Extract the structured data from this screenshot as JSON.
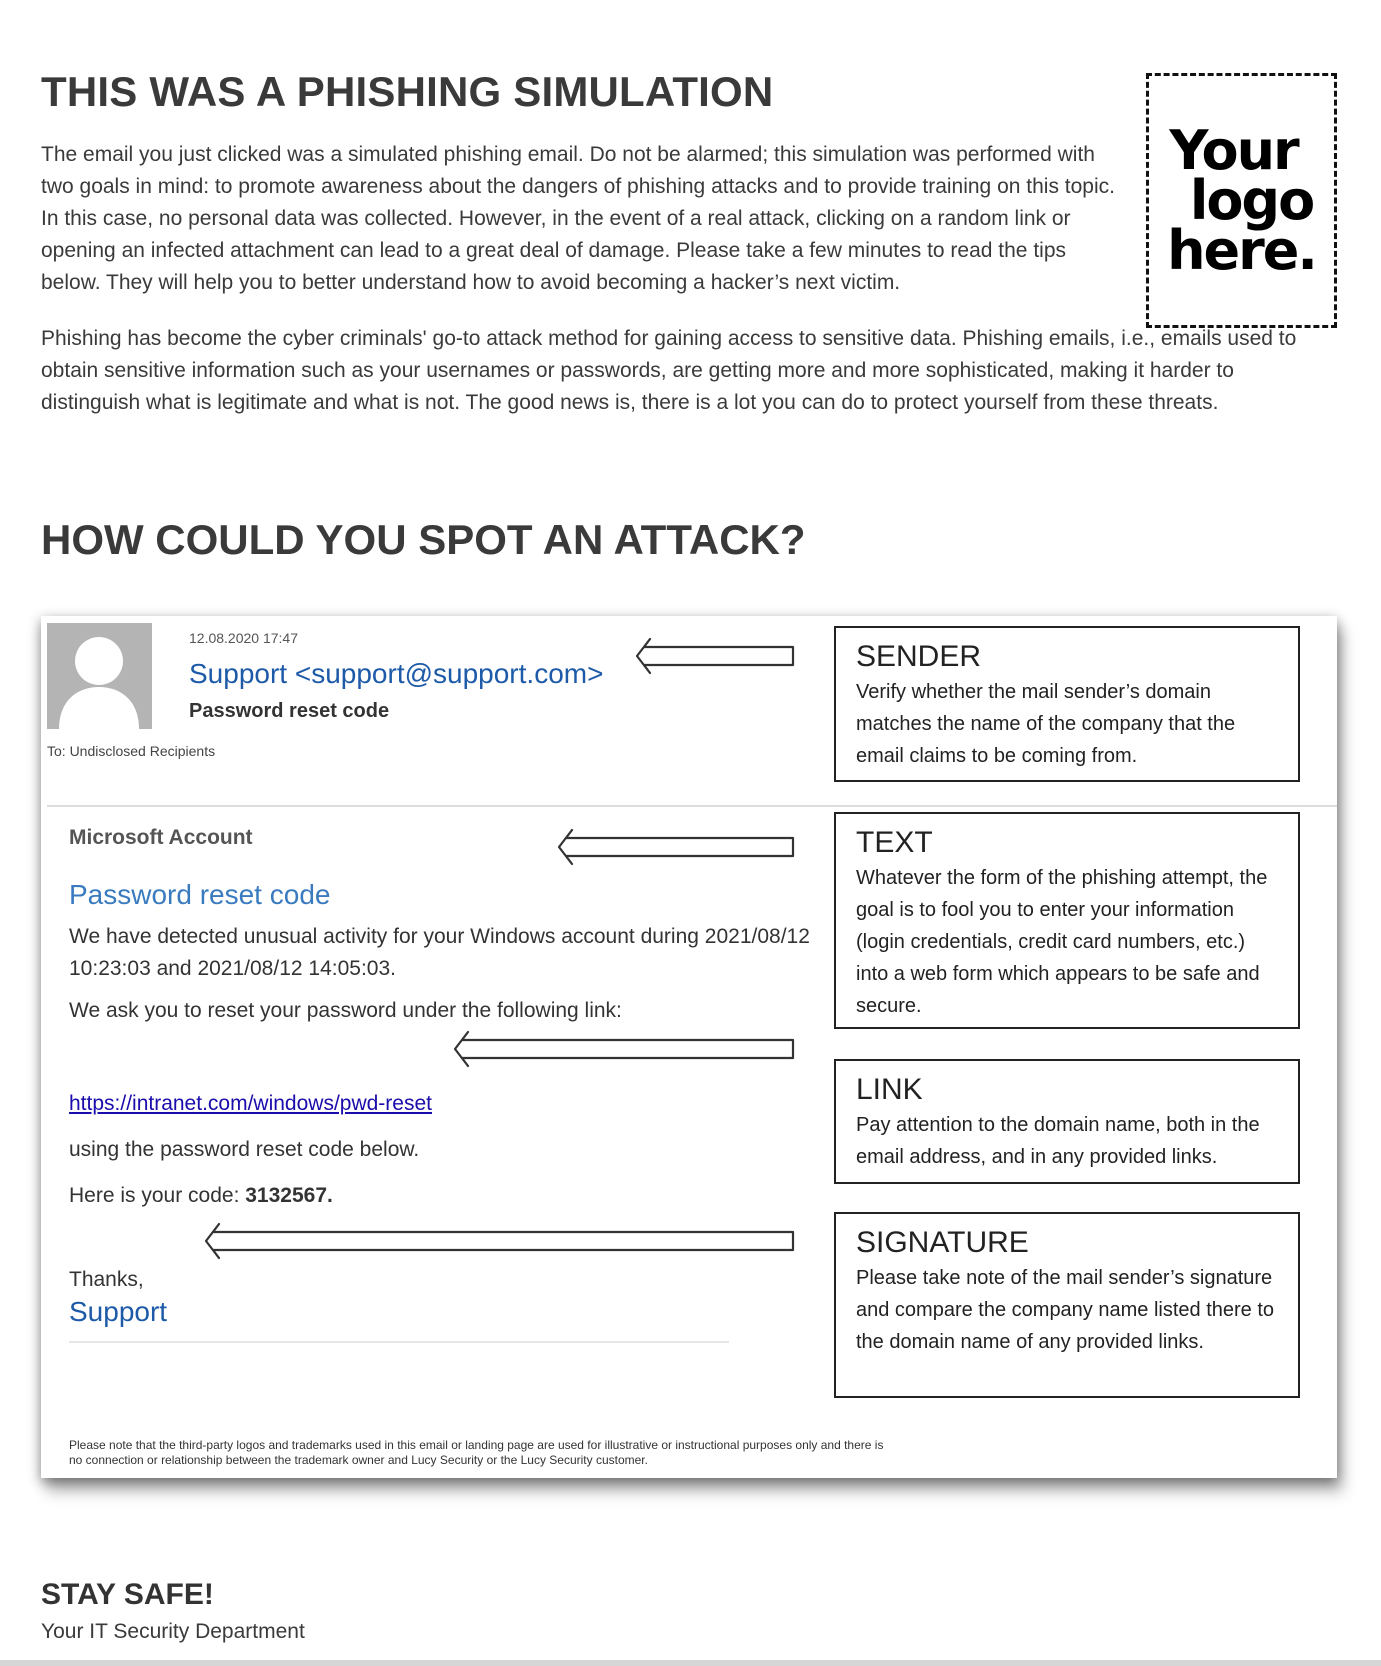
{
  "intro": {
    "title": "THIS WAS A PHISHING SIMULATION",
    "paragraph1": "The email you just clicked was a simulated phishing email. Do not be alarmed; this simulation was performed with two goals in mind: to promote awareness about the dangers of phishing attacks and to provide training on this topic. In this case, no personal data was collected. However, in the event of a real attack, clicking on a random link or opening an infected attachment can lead to a great deal of damage. Please take a few minutes to read the tips below. They will help you to better understand how to avoid becoming a hacker’s next victim.",
    "paragraph2": "Phishing has become the cyber criminals' go-to attack method for gaining access to sensitive data. Phishing emails, i.e., emails used to obtain sensitive information such as your usernames or passwords, are getting more and more sophisticated, making it harder to distinguish what is legitimate and what is not. The good news is, there is a lot you can do to protect yourself from these threats."
  },
  "logo": {
    "line1": "Your",
    "line2": "logo",
    "line3": "here."
  },
  "section2": {
    "title": "HOW COULD YOU SPOT AN ATTACK?"
  },
  "email": {
    "date": "12.08.2020 17:47",
    "sender": "Support <support@support.com>",
    "subject": "Password reset code",
    "to": "To: Undisclosed Recipients",
    "brand": "Microsoft Account",
    "title": "Password reset code",
    "body": "We have detected unusual activity for your Windows account during 2021/08/12 10:23:03 and 2021/08/12 14:05:03.",
    "ask": "We ask you to reset your password under the following link:",
    "link": "https://intranet.com/windows/pwd-reset",
    "using": "using the password reset code below.",
    "code_prefix": "Here is your code: ",
    "code": "3132567.",
    "thanks": "Thanks,",
    "signature": "Support",
    "disclaimer": "Please note that the third-party logos and trademarks used in this email or landing page are used for illustrative or instructional purposes only and there is no connection or relationship between the trademark owner and Lucy Security or the Lucy Security customer."
  },
  "callouts": {
    "sender": {
      "title": "SENDER",
      "text": "Verify whether the mail sender’s domain matches the name of the company that the email claims to be coming from."
    },
    "text": {
      "title": "TEXT",
      "text": "Whatever the form of the phishing attempt, the goal is to fool you to enter your information (login credentials, credit card numbers, etc.) into a web form which appears to be safe and secure."
    },
    "link": {
      "title": "LINK",
      "text": "Pay attention to the domain name, both in the email address, and in any provided links."
    },
    "signature": {
      "title": "SIGNATURE",
      "text": "Please take note of the mail sender’s signature and compare the company name listed there to the domain name of any provided links."
    }
  },
  "footer": {
    "stay": "STAY SAFE!",
    "department": "Your IT Security Department"
  },
  "icons": {
    "avatar": "person-placeholder-icon",
    "arrow": "arrow-left-icon"
  },
  "colors": {
    "link_blue": "#1d5aa8",
    "title_blue": "#3a7bbf",
    "hyperlink": "#1a0dab"
  }
}
